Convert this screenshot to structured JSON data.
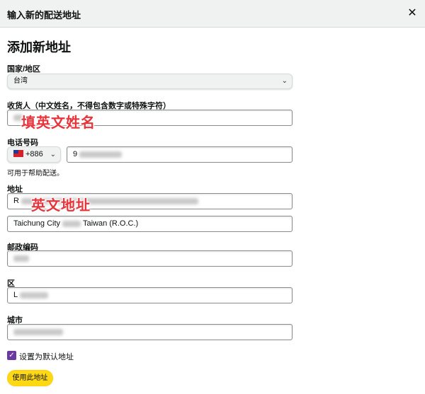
{
  "header": {
    "title": "输入新的配送地址",
    "close_icon": "close-icon"
  },
  "form": {
    "title": "添加新地址",
    "country": {
      "label": "国家/地区",
      "value": "台湾"
    },
    "recipient": {
      "label": "收货人（中文姓名，不得包含数字或特殊字符）",
      "overlay": "填英文姓名"
    },
    "phone": {
      "label": "电话号码",
      "code": "+886",
      "value": "9",
      "hint": "可用于帮助配送。"
    },
    "address": {
      "label": "地址",
      "line1": "R",
      "overlay": "英文地址",
      "line2": "Taichung City",
      "line2_suffix": "Taiwan (R.O.C.)"
    },
    "postal": {
      "label": "邮政编码"
    },
    "district": {
      "label": "区",
      "value": "L"
    },
    "city": {
      "label": "城市"
    },
    "default": {
      "label": "设置为默认地址",
      "checked": true
    },
    "submit_label": "使用此地址"
  },
  "colors": {
    "accent_button": "#ffd814",
    "overlay_text": "#e8333a",
    "checkbox": "#6b3aa0"
  }
}
